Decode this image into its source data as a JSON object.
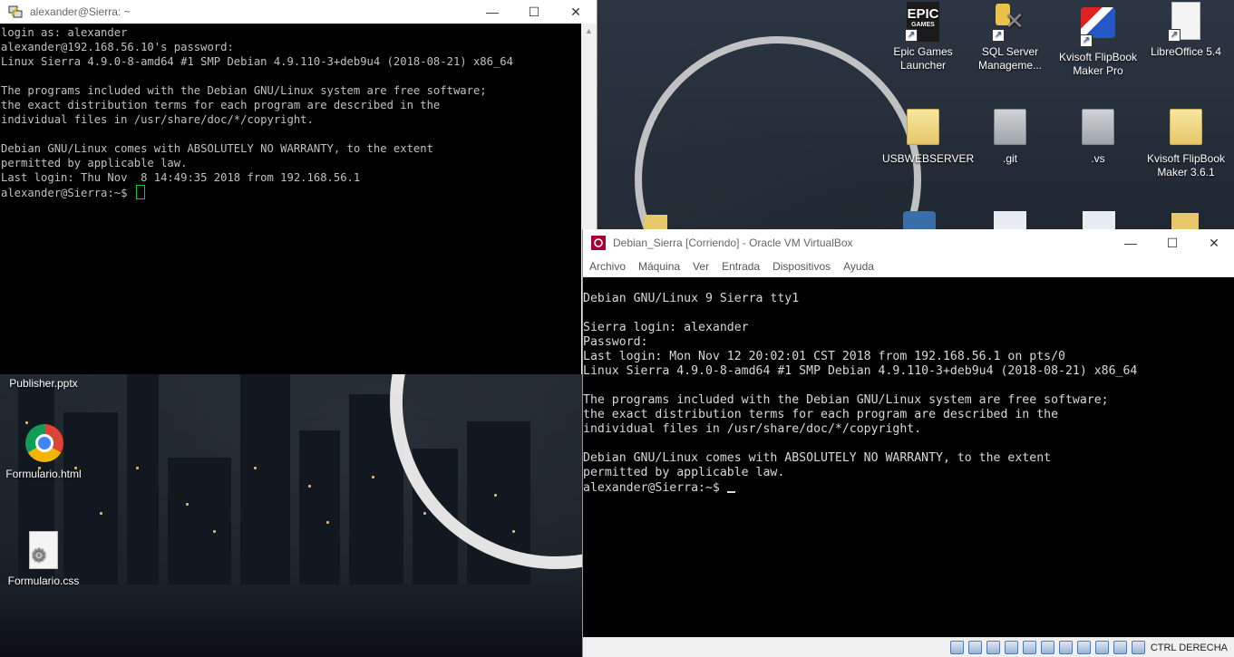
{
  "desktop": {
    "icons": [
      {
        "label": "Epic Games Launcher"
      },
      {
        "label": "SQL Server Manageme..."
      },
      {
        "label": "Kvisoft FlipBook Maker Pro"
      },
      {
        "label": "LibreOffice 5.4"
      },
      {
        "label": "USBWEBSERVER"
      },
      {
        "label": ".git"
      },
      {
        "label": ".vs"
      },
      {
        "label": "Kvisoft FlipBook Maker 3.6.1"
      },
      {
        "label": "Publisher.pptx"
      },
      {
        "label": "Formulario.html"
      },
      {
        "label": "Formulario.css"
      }
    ],
    "epic_logo_text": "EPIC",
    "epic_logo_sub": "GAMES"
  },
  "putty": {
    "title": "alexander@Sierra: ~",
    "lines": [
      "login as: alexander",
      "alexander@192.168.56.10's password:",
      "Linux Sierra 4.9.0-8-amd64 #1 SMP Debian 4.9.110-3+deb9u4 (2018-08-21) x86_64",
      "",
      "The programs included with the Debian GNU/Linux system are free software;",
      "the exact distribution terms for each program are described in the",
      "individual files in /usr/share/doc/*/copyright.",
      "",
      "Debian GNU/Linux comes with ABSOLUTELY NO WARRANTY, to the extent",
      "permitted by applicable law.",
      "Last login: Thu Nov  8 14:49:35 2018 from 192.168.56.1"
    ],
    "prompt": "alexander@Sierra:~$ "
  },
  "vbox": {
    "title": "Debian_Sierra [Corriendo] - Oracle VM VirtualBox",
    "menu": [
      "Archivo",
      "Máquina",
      "Ver",
      "Entrada",
      "Dispositivos",
      "Ayuda"
    ],
    "lines": [
      "Debian GNU/Linux 9 Sierra tty1",
      "",
      "Sierra login: alexander",
      "Password:",
      "Last login: Mon Nov 12 20:02:01 CST 2018 from 192.168.56.1 on pts/0",
      "Linux Sierra 4.9.0-8-amd64 #1 SMP Debian 4.9.110-3+deb9u4 (2018-08-21) x86_64",
      "",
      "The programs included with the Debian GNU/Linux system are free software;",
      "the exact distribution terms for each program are described in the",
      "individual files in /usr/share/doc/*/copyright.",
      "",
      "Debian GNU/Linux comes with ABSOLUTELY NO WARRANTY, to the extent",
      "permitted by applicable law."
    ],
    "prompt": "alexander@Sierra:~$ ",
    "host_key": "CTRL DERECHA"
  },
  "window_controls": {
    "minimize": "—",
    "maximize": "☐",
    "close": "✕"
  }
}
